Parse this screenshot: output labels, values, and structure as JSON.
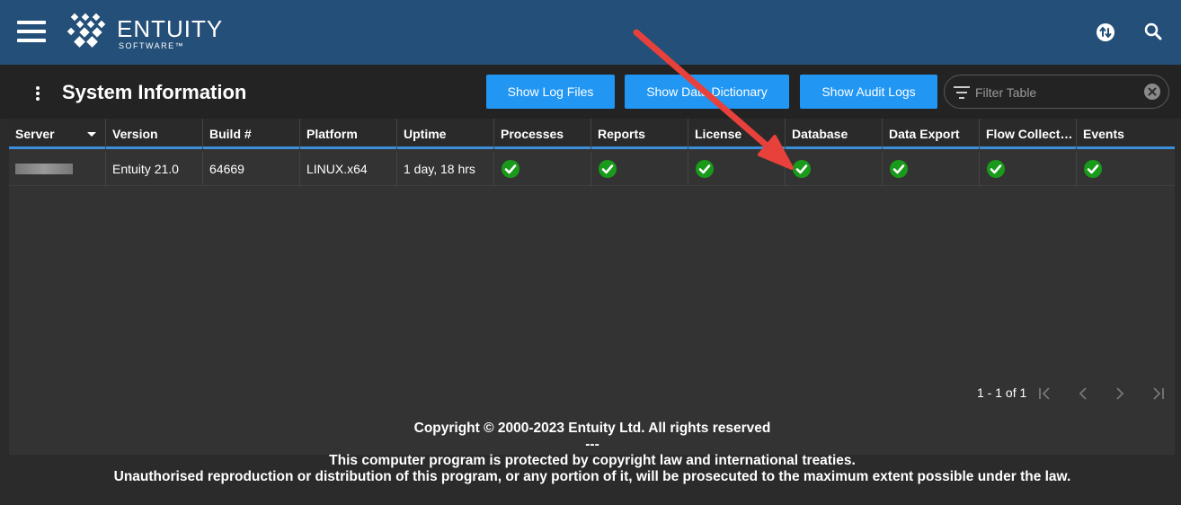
{
  "header": {
    "logo_text": "ENTUITY",
    "logo_subtext": "SOFTWARE™"
  },
  "toolbar": {
    "title": "System Information",
    "buttons": {
      "log_files": "Show Log Files",
      "data_dictionary": "Show Data Dictionary",
      "audit_logs": "Show Audit Logs"
    },
    "filter_placeholder": "Filter Table"
  },
  "table": {
    "columns": [
      "Server",
      "Version",
      "Build #",
      "Platform",
      "Uptime",
      "Processes",
      "Reports",
      "License",
      "Database",
      "Data Export",
      "Flow Collect…",
      "Events"
    ],
    "rows": [
      {
        "server": "",
        "version": "Entuity 21.0",
        "build": "64669",
        "platform": "LINUX.x64",
        "uptime": "1 day, 18 hrs",
        "statuses": [
          "ok",
          "ok",
          "ok",
          "ok",
          "ok",
          "ok",
          "ok"
        ]
      }
    ],
    "status_color": "#1a9a1a"
  },
  "pagination": {
    "range": "1 - 1 of 1"
  },
  "footer": {
    "line1": "Copyright © 2000-2023 Entuity Ltd. All rights reserved",
    "line2": "---",
    "line3": "This computer program is protected by copyright law and international treaties.",
    "line4": "Unauthorised reproduction or distribution of this program, or any portion of it, will be prosecuted to the maximum extent possible under the law."
  },
  "colors": {
    "header_bg": "#244f78",
    "button_bg": "#2196f3",
    "annotation_arrow": "#e8413c"
  }
}
